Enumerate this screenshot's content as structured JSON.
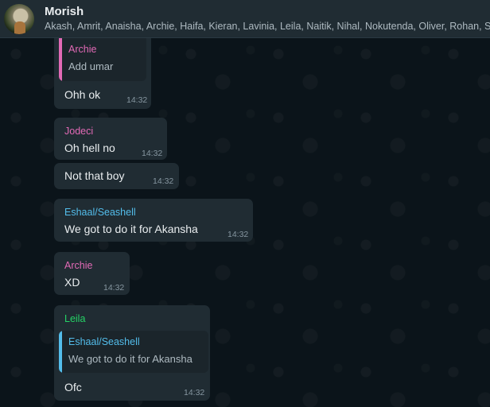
{
  "header": {
    "group_name": "Morish",
    "members": "Akash, Amrit, Anaisha, Archie, Haifa, Kieran, Lavinia, Leila, Naitik, Nihal, Nokutenda, Oliver, Rohan, Sultan, Tanish, You"
  },
  "colors": {
    "background": "#0b141a",
    "bubble": "#202c33",
    "archie": "#e26ab6",
    "jodeci": "#e26ab6",
    "eshaal": "#53bdeb",
    "leila": "#25d366"
  },
  "messages": [
    {
      "quote": {
        "sender": "Archie",
        "text": "Add umar"
      },
      "text": "Ohh ok",
      "time": "14:32"
    },
    {
      "sender": "Jodeci",
      "text": "Oh hell no",
      "time": "14:32"
    },
    {
      "text": "Not that boy",
      "time": "14:32"
    },
    {
      "sender": "Eshaal/Seashell",
      "text": "We got to do it for Akansha",
      "time": "14:32"
    },
    {
      "sender": "Archie",
      "text": "XD",
      "time": "14:32"
    },
    {
      "sender": "Leila",
      "quote": {
        "sender": "Eshaal/Seashell",
        "text": "We got to do it for Akansha"
      },
      "text": "Ofc",
      "time": "14:32"
    }
  ]
}
